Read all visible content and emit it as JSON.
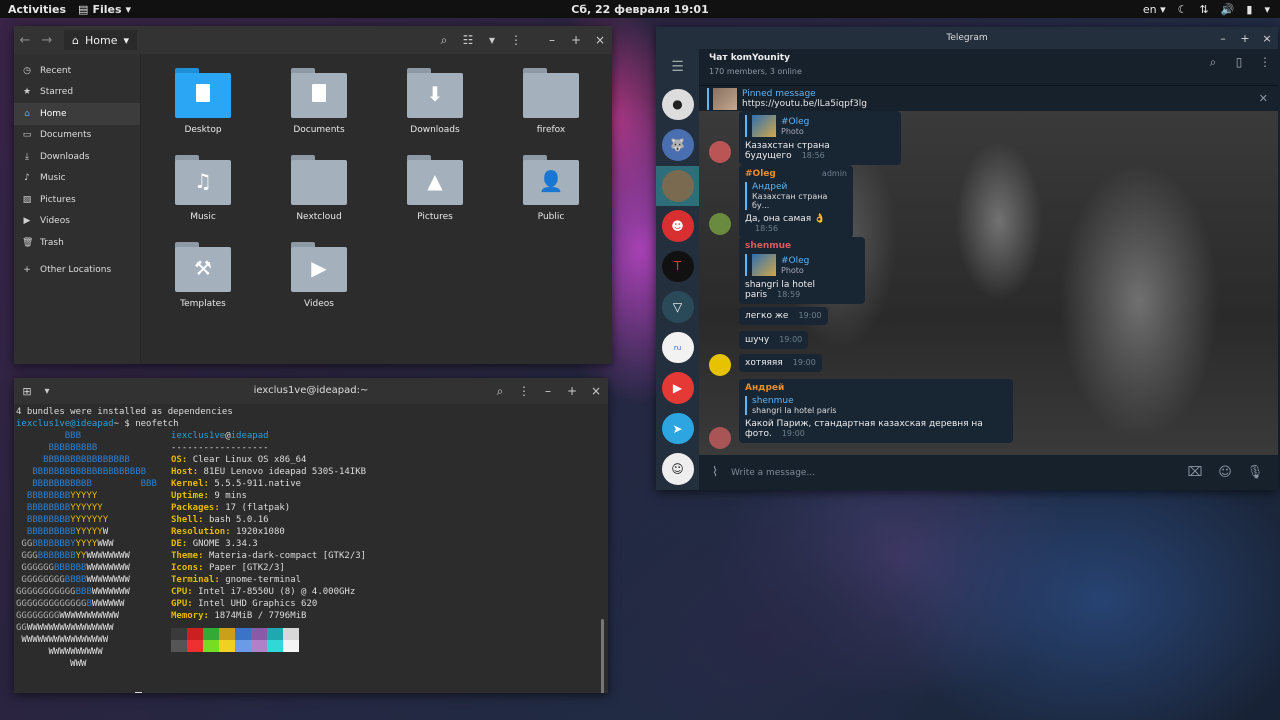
{
  "topbar": {
    "activities": "Activities",
    "app_name": "Files",
    "clock": "Сб, 22 февраля  19:01",
    "lang": "en"
  },
  "files": {
    "breadcrumb": "Home",
    "sidebar": [
      {
        "label": "Recent",
        "icon": "clock-icon"
      },
      {
        "label": "Starred",
        "icon": "star-icon"
      },
      {
        "label": "Home",
        "icon": "home-icon"
      },
      {
        "label": "Documents",
        "icon": "document-icon"
      },
      {
        "label": "Downloads",
        "icon": "download-icon"
      },
      {
        "label": "Music",
        "icon": "music-icon"
      },
      {
        "label": "Pictures",
        "icon": "picture-icon"
      },
      {
        "label": "Videos",
        "icon": "video-icon"
      },
      {
        "label": "Trash",
        "icon": "trash-icon"
      }
    ],
    "other_locations": "Other Locations",
    "folders": [
      {
        "label": "Desktop"
      },
      {
        "label": "Documents"
      },
      {
        "label": "Downloads"
      },
      {
        "label": "firefox"
      },
      {
        "label": "Music"
      },
      {
        "label": "Nextcloud"
      },
      {
        "label": "Pictures"
      },
      {
        "label": "Public"
      },
      {
        "label": "Templates"
      },
      {
        "label": "Videos"
      }
    ]
  },
  "terminal": {
    "title": "iexclus1ve@ideapad:~",
    "line1": "4 bundles were installed as dependencies",
    "prompt_user": "iexclus1ve@ideapad",
    "prompt_suffix": "~ $ neofetch",
    "prompt_suffix2": "~ $ ",
    "info_user": "iexclus1ve",
    "info_at": "@",
    "info_host": "ideapad",
    "info_sep": "------------------",
    "info": [
      {
        "k": "OS",
        "v": "Clear Linux OS x86_64"
      },
      {
        "k": "Host",
        "v": "81EU Lenovo ideapad 530S-14IKB"
      },
      {
        "k": "Kernel",
        "v": "5.5.5-911.native"
      },
      {
        "k": "Uptime",
        "v": "9 mins"
      },
      {
        "k": "Packages",
        "v": "17 (flatpak)"
      },
      {
        "k": "Shell",
        "v": "bash 5.0.16"
      },
      {
        "k": "Resolution",
        "v": "1920x1080"
      },
      {
        "k": "DE",
        "v": "GNOME 3.34.3"
      },
      {
        "k": "Theme",
        "v": "Materia-dark-compact [GTK2/3]"
      },
      {
        "k": "Icons",
        "v": "Paper [GTK2/3]"
      },
      {
        "k": "Terminal",
        "v": "gnome-terminal"
      },
      {
        "k": "CPU",
        "v": "Intel i7-8550U (8) @ 4.000GHz"
      },
      {
        "k": "GPU",
        "v": "Intel UHD Graphics 620"
      },
      {
        "k": "Memory",
        "v": "1874MiB / 7796MiB"
      }
    ],
    "palette_top": [
      "#3a3a3a",
      "#cc2020",
      "#33aa33",
      "#c9a018",
      "#3b73c9",
      "#8a5aa8",
      "#20a8b0",
      "#d8d8d8"
    ],
    "palette_bottom": [
      "#555555",
      "#ee3030",
      "#77dd22",
      "#f0d020",
      "#6a9ae8",
      "#b080c8",
      "#30d8d8",
      "#f4f4f4"
    ]
  },
  "telegram": {
    "title": "Telegram",
    "chat_name": "Чат komYounity",
    "chat_status": "170 members, 3 online",
    "pinned_title": "Pinned message",
    "pinned_text": "https://youtu.be/lLa5iqpf3lg",
    "input_placeholder": "Write a message...",
    "messages": {
      "m1": {
        "reply_name": "#Oleg",
        "reply_sub": "Photo",
        "text": "Казахстан страна будущего",
        "time": "18:56"
      },
      "m2": {
        "sender": "#Oleg",
        "admin": "admin",
        "reply_name": "Андрей",
        "reply_sub": "Казахстан страна бу...",
        "text": "Да, она самая 👌",
        "time": "18:56"
      },
      "m3": {
        "sender": "shenmue",
        "reply_name": "#Oleg",
        "reply_sub": "Photo",
        "text": "shangri la hotel paris",
        "time": "18:59"
      },
      "m4": {
        "text": "легко же",
        "time": "19:00"
      },
      "m5": {
        "text": "шучу",
        "time": "19:00"
      },
      "m6": {
        "text": "хотяяяя",
        "time": "19:00"
      },
      "m7": {
        "sender": "Андрей",
        "reply_name": "shenmue",
        "reply_sub": "shangri la hotel paris",
        "text": "Какой Париж, стандартная казахская деревня на фото.",
        "time": "19:00"
      }
    },
    "colors": {
      "accent": "#5eb5f7",
      "oleg": "#e88d2c",
      "shenmue": "#e05a5a",
      "andrey": "#e88d2c"
    }
  }
}
